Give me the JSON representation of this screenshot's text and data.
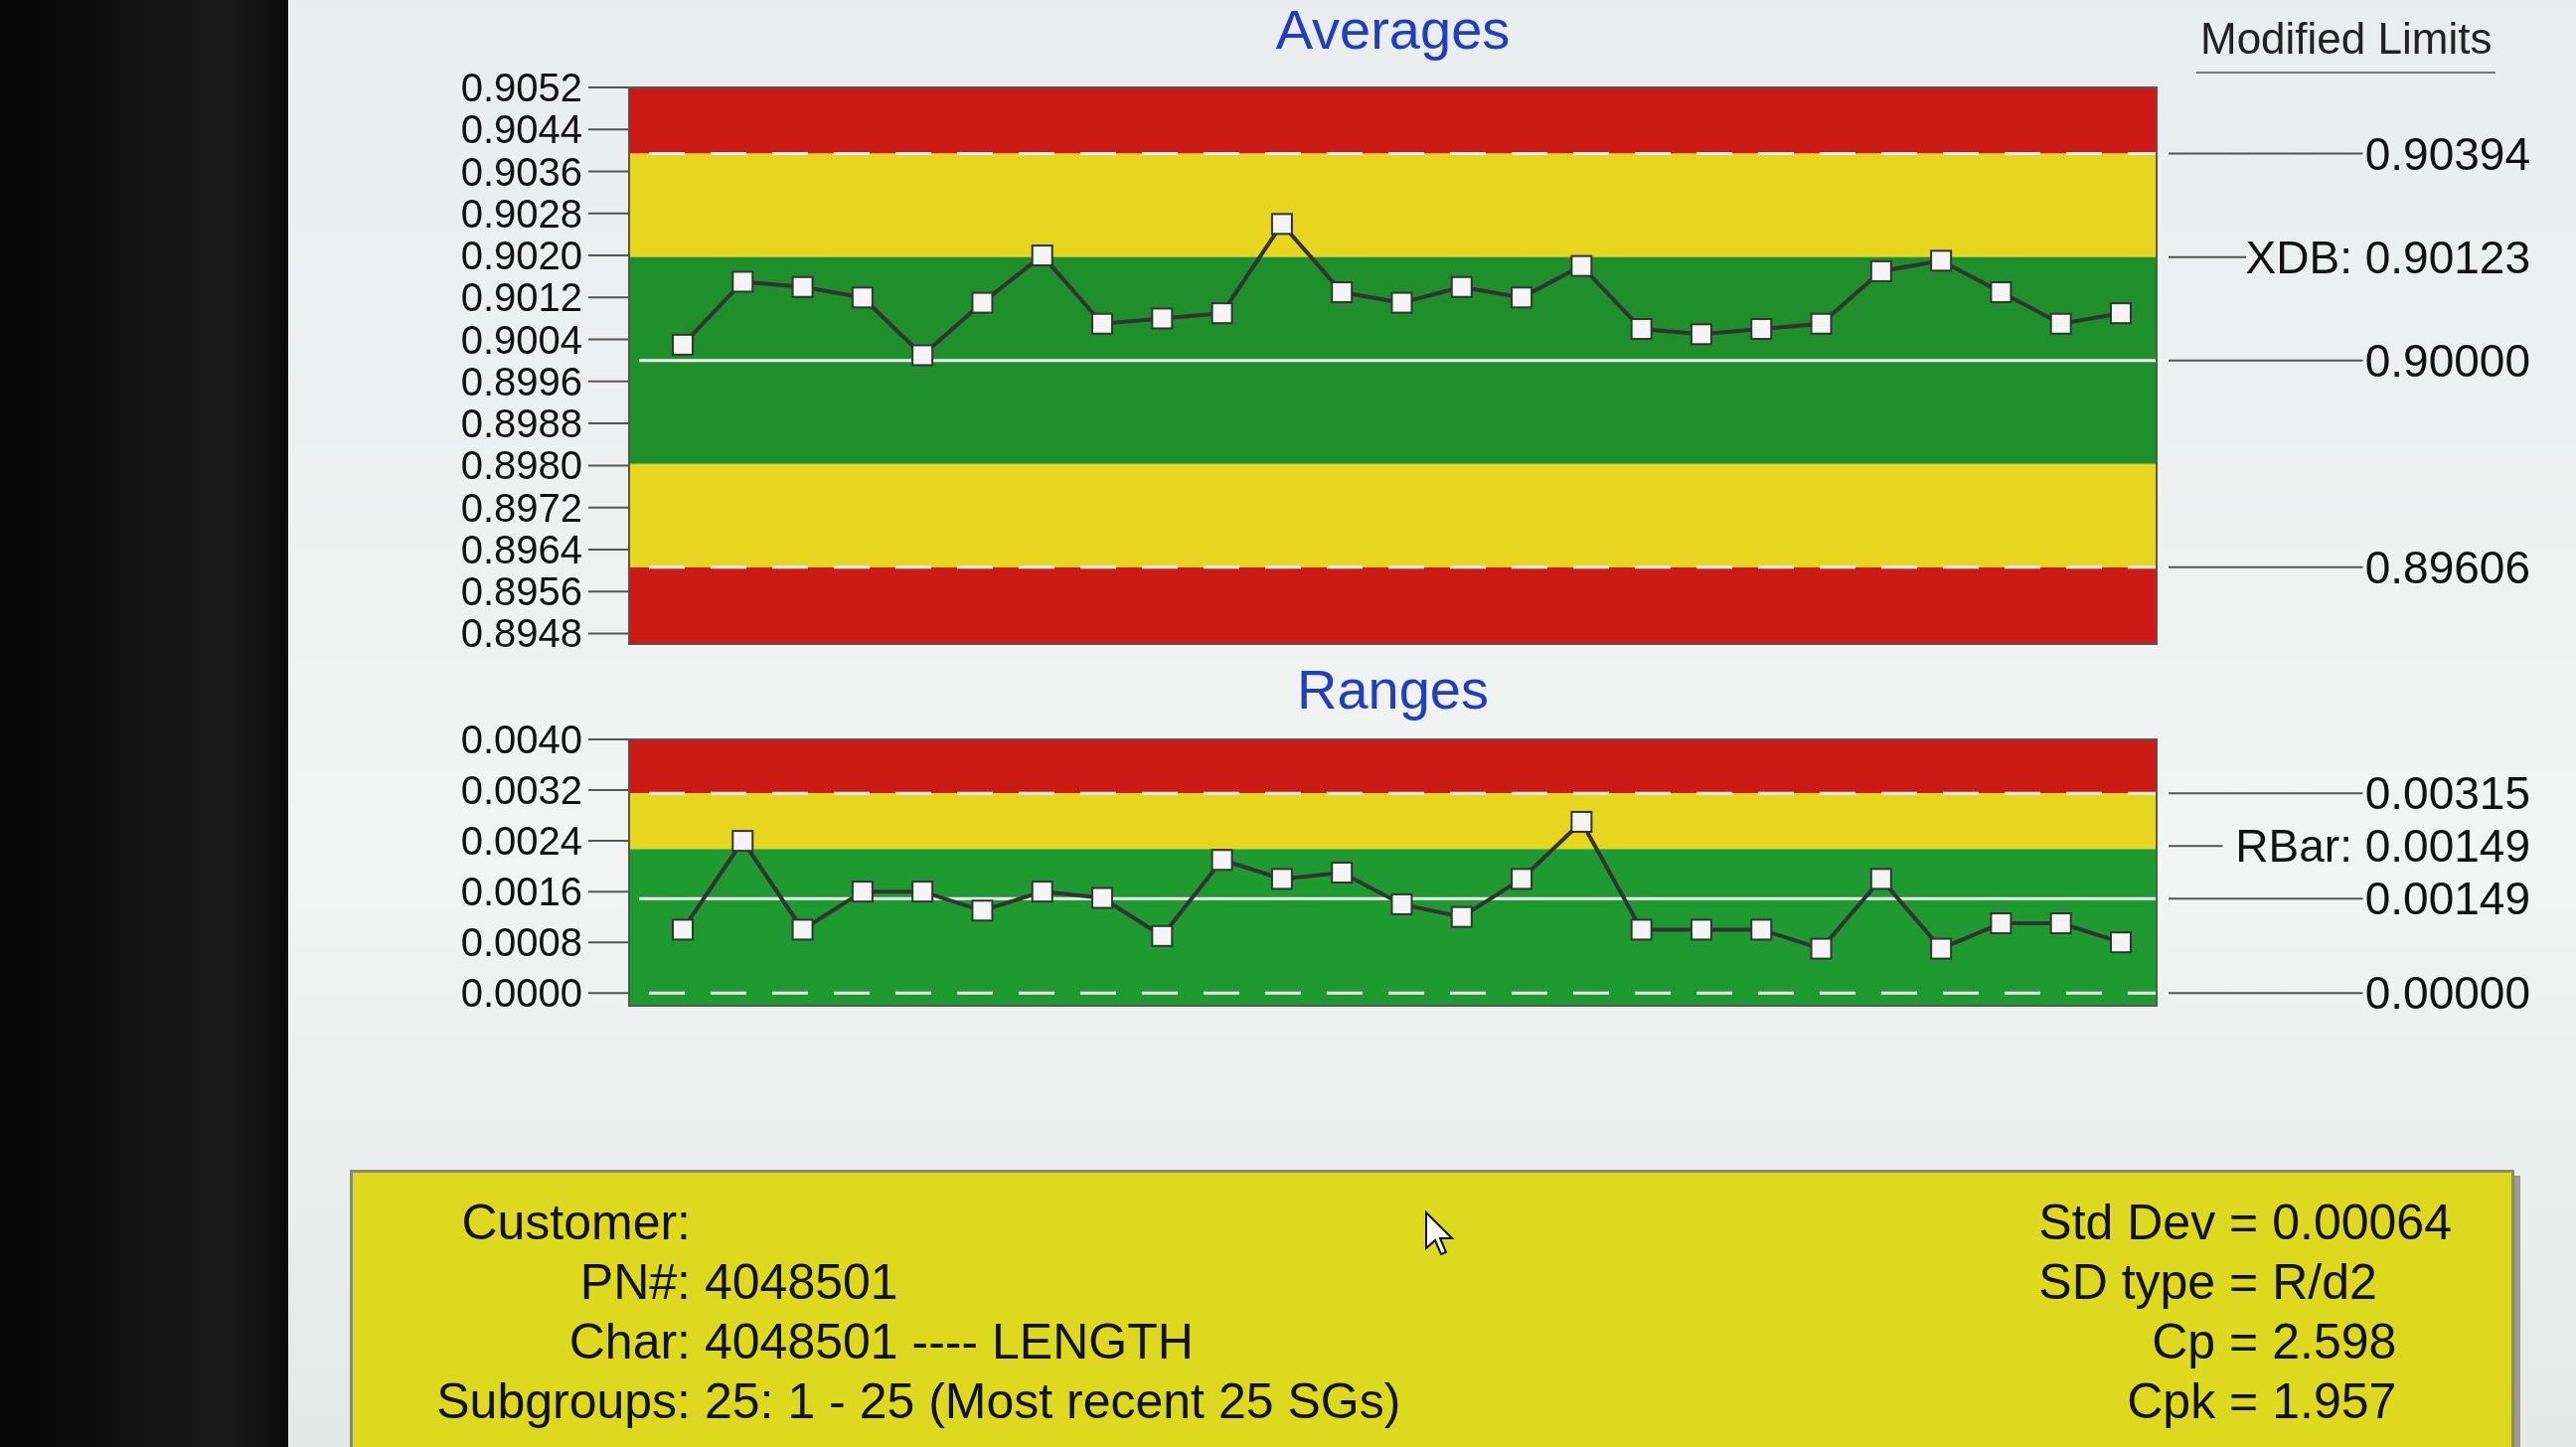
{
  "header_label": "Modified Limits",
  "averages_chart": {
    "chart_data": {
      "type": "line",
      "title": "Averages",
      "series": [
        {
          "color": "#333333",
          "marker": "square",
          "values": [
            0.9003,
            0.9015,
            0.9014,
            0.9012,
            0.9001,
            0.9011,
            0.902,
            0.9007,
            0.9008,
            0.9009,
            0.9026,
            0.9013,
            0.9011,
            0.9014,
            0.9012,
            0.9018,
            0.9006,
            0.9005,
            0.9006,
            0.9007,
            0.9017,
            0.9019,
            0.9013,
            0.9007,
            0.9009
          ]
        }
      ],
      "ylim": [
        0.8946,
        0.9052
      ],
      "yticks": [
        {
          "value": 0.9052,
          "label": "0.9052"
        },
        {
          "value": 0.9044,
          "label": "0.9044"
        },
        {
          "value": 0.9036,
          "label": "0.9036"
        },
        {
          "value": 0.9028,
          "label": "0.9028"
        },
        {
          "value": 0.902,
          "label": "0.9020"
        },
        {
          "value": 0.9012,
          "label": "0.9012"
        },
        {
          "value": 0.9004,
          "label": "0.9004"
        },
        {
          "value": 0.8996,
          "label": "0.8996"
        },
        {
          "value": 0.8988,
          "label": "0.8988"
        },
        {
          "value": 0.898,
          "label": "0.8980"
        },
        {
          "value": 0.8972,
          "label": "0.8972"
        },
        {
          "value": 0.8964,
          "label": "0.8964"
        },
        {
          "value": 0.8956,
          "label": "0.8956"
        },
        {
          "value": 0.8948,
          "label": "0.8948"
        }
      ],
      "bands": [
        {
          "axis": "y",
          "from": 0.90394,
          "to": 0.9052,
          "color": "#cc1a14"
        },
        {
          "axis": "y",
          "from": 0.90197,
          "to": 0.90394,
          "color": "#e6d620"
        },
        {
          "axis": "y",
          "from": 0.89803,
          "to": 0.90197,
          "color": "#1f8f2c"
        },
        {
          "axis": "y",
          "from": 0.89606,
          "to": 0.89803,
          "color": "#e6d620"
        },
        {
          "axis": "y",
          "from": 0.8946,
          "to": 0.89606,
          "color": "#cc1a14"
        }
      ],
      "ref_lines": [
        {
          "axis": "y",
          "value": 0.90394,
          "label": "0.90394"
        },
        {
          "axis": "y",
          "value": 0.9,
          "label": "0.90000"
        },
        {
          "axis": "y",
          "value": 0.89606,
          "label": "0.89606"
        }
      ],
      "annotations": [
        "XDB: 0.90123"
      ]
    }
  },
  "ranges_chart": {
    "chart_data": {
      "type": "line",
      "title": "Ranges",
      "series": [
        {
          "color": "#333333",
          "marker": "square",
          "values": [
            0.001,
            0.0024,
            0.001,
            0.0016,
            0.0016,
            0.0013,
            0.0016,
            0.0015,
            0.0009,
            0.0021,
            0.0018,
            0.0019,
            0.0014,
            0.0012,
            0.0018,
            0.0027,
            0.001,
            0.001,
            0.001,
            0.0007,
            0.0018,
            0.0007,
            0.0011,
            0.0011,
            0.0008
          ]
        }
      ],
      "ylim": [
        -0.0002,
        0.004
      ],
      "yticks": [
        {
          "value": 0.004,
          "label": "0.0040"
        },
        {
          "value": 0.0032,
          "label": "0.0032"
        },
        {
          "value": 0.0024,
          "label": "0.0024"
        },
        {
          "value": 0.0016,
          "label": "0.0016"
        },
        {
          "value": 0.0008,
          "label": "0.0008"
        },
        {
          "value": 0,
          "label": "0.0000"
        }
      ],
      "bands": [
        {
          "axis": "y",
          "from": 0.00315,
          "to": 0.004,
          "color": "#cc1a14"
        },
        {
          "axis": "y",
          "from": 0.00227,
          "to": 0.00315,
          "color": "#e6d620"
        },
        {
          "axis": "y",
          "from": -0.0002,
          "to": 0.00227,
          "color": "#1f9a30"
        }
      ],
      "ref_lines": [
        {
          "axis": "y",
          "value": 0.00315,
          "label": "0.00315"
        },
        {
          "axis": "y",
          "value": 0.00149,
          "label": "0.00149"
        },
        {
          "axis": "y",
          "value": 0,
          "label": "0.00000"
        }
      ],
      "annotations": [
        "RBar: 0.00149"
      ]
    }
  },
  "info_panel": {
    "left": [
      {
        "label": "Customer:"
      },
      {
        "label": "PN#:",
        "value": "4048501"
      },
      {
        "label": "Char:",
        "value": "4048501 ---- LENGTH"
      },
      {
        "label": "Subgroups:",
        "value": "25: 1 - 25 (Most recent 25 SGs)"
      }
    ],
    "right": [
      {
        "label": "Std Dev =",
        "value": "0.00064"
      },
      {
        "label": "SD type =",
        "value": "R/d2"
      },
      {
        "label": "Cp =",
        "value": "2.598"
      },
      {
        "label": "Cpk =",
        "value": "1.957"
      }
    ]
  }
}
